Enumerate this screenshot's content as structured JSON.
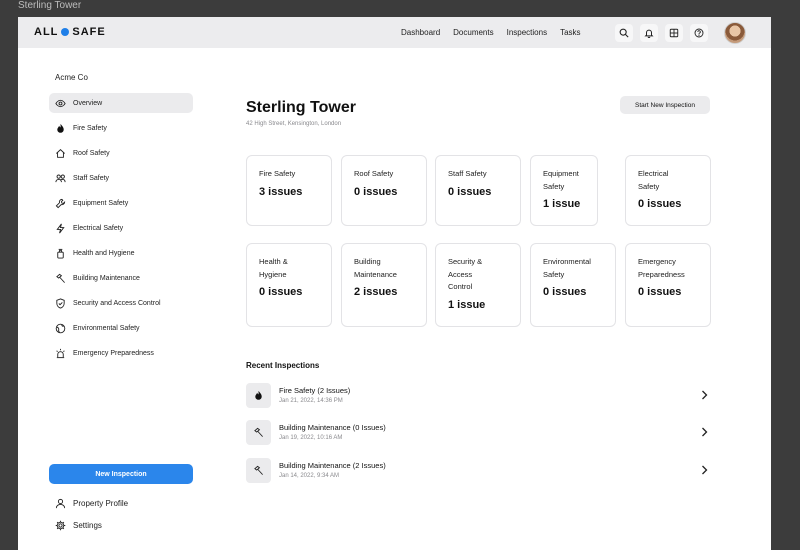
{
  "window_title": "Sterling Tower",
  "brand": {
    "left": "ALL",
    "right": "SAFE",
    "accent": "#1f7fe8"
  },
  "nav": [
    "Dashboard",
    "Documents",
    "Inspections",
    "Tasks"
  ],
  "toolbar_icons": [
    "search-icon",
    "bell-icon",
    "grid-icon",
    "help-icon"
  ],
  "sidebar": {
    "company": "Acme Co",
    "items": [
      {
        "label": "Overview",
        "icon": "eye-icon",
        "active": true
      },
      {
        "label": "Fire Safety",
        "icon": "flame-icon"
      },
      {
        "label": "Roof Safety",
        "icon": "house-icon"
      },
      {
        "label": "Staff Safety",
        "icon": "people-icon"
      },
      {
        "label": "Equipment Safety",
        "icon": "wrench-icon"
      },
      {
        "label": "Electrical Safety",
        "icon": "bolt-icon"
      },
      {
        "label": "Health and Hygiene",
        "icon": "bottle-icon"
      },
      {
        "label": "Building Maintenance",
        "icon": "hammer-icon"
      },
      {
        "label": "Security and Access Control",
        "icon": "shield-icon"
      },
      {
        "label": "Environmental Safety",
        "icon": "globe-icon"
      },
      {
        "label": "Emergency Preparedness",
        "icon": "siren-icon"
      }
    ],
    "new_inspection": "New Inspection",
    "property_profile": "Property Profile",
    "settings": "Settings"
  },
  "page": {
    "title": "Sterling Tower",
    "address": "42 High Street, Kensington, London",
    "start_button": "Start New Inspection"
  },
  "cards": [
    {
      "name": "Fire Safety",
      "count": "3 issues"
    },
    {
      "name": "Roof Safety",
      "count": "0 issues"
    },
    {
      "name": "Staff Safety",
      "count": "0 issues"
    },
    {
      "name": "Equipment Safety",
      "count": "1 issue"
    },
    {
      "name": "Electrical Safety",
      "count": "0 issues"
    },
    {
      "name": "Health & Hygiene",
      "count": "0 issues"
    },
    {
      "name": "Building Maintenance",
      "count": "2 issues"
    },
    {
      "name": "Security & Access Control",
      "count": "1 issue"
    },
    {
      "name": "Environmental Safety",
      "count": "0 issues"
    },
    {
      "name": "Emergency Preparedness",
      "count": "0 issues"
    }
  ],
  "recent": {
    "title": "Recent Inspections",
    "items": [
      {
        "title": "Fire Safety (2 Issues)",
        "date": "Jan 21, 2022, 14:36 PM",
        "icon": "flame-icon"
      },
      {
        "title": "Building Maintenance (0 Issues)",
        "date": "Jan 19, 2022, 10:16 AM",
        "icon": "hammer-icon"
      },
      {
        "title": "Building Maintenance (2 Issues)",
        "date": "Jan 14, 2022, 9:34 AM",
        "icon": "hammer-icon"
      }
    ]
  }
}
